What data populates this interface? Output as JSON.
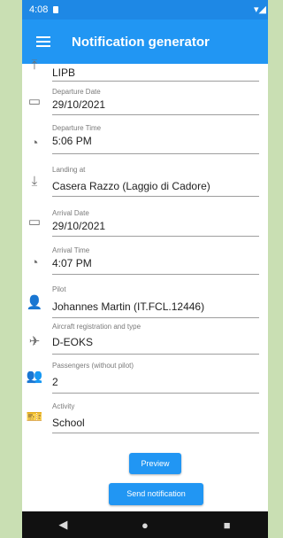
{
  "status_bar": {
    "time": "4:08"
  },
  "app_bar": {
    "title": "Notification generator"
  },
  "form": {
    "departure_airfield": "LIPB",
    "departure_date": {
      "label": "Departure Date",
      "value": "29/10/2021"
    },
    "departure_time": {
      "label": "Departure Time",
      "value": "5:06 PM"
    },
    "landing_at": {
      "label": "Landing at",
      "value": "Casera Razzo (Laggio di Cadore)"
    },
    "arrival_date": {
      "label": "Arrival Date",
      "value": "29/10/2021"
    },
    "arrival_time": {
      "label": "Arrival Time",
      "value": "4:07 PM"
    },
    "pilot": {
      "label": "Pilot",
      "value": "Johannes Martin (IT.FCL.12446)"
    },
    "aircraft": {
      "label": "Aircraft registration and type",
      "value": "D-EOKS"
    },
    "passengers": {
      "label": "Passengers (without pilot)",
      "value": "2"
    },
    "activity": {
      "label": "Activity",
      "value": "School"
    }
  },
  "buttons": {
    "preview": "Preview",
    "send": "Send notification"
  },
  "nav": {
    "back": "◀",
    "home": "●",
    "recents": "■"
  },
  "colors": {
    "app_bar": "#2196f3",
    "status_bar": "#1e88e5",
    "button": "#2196f3",
    "background": "#c9dfb3"
  }
}
